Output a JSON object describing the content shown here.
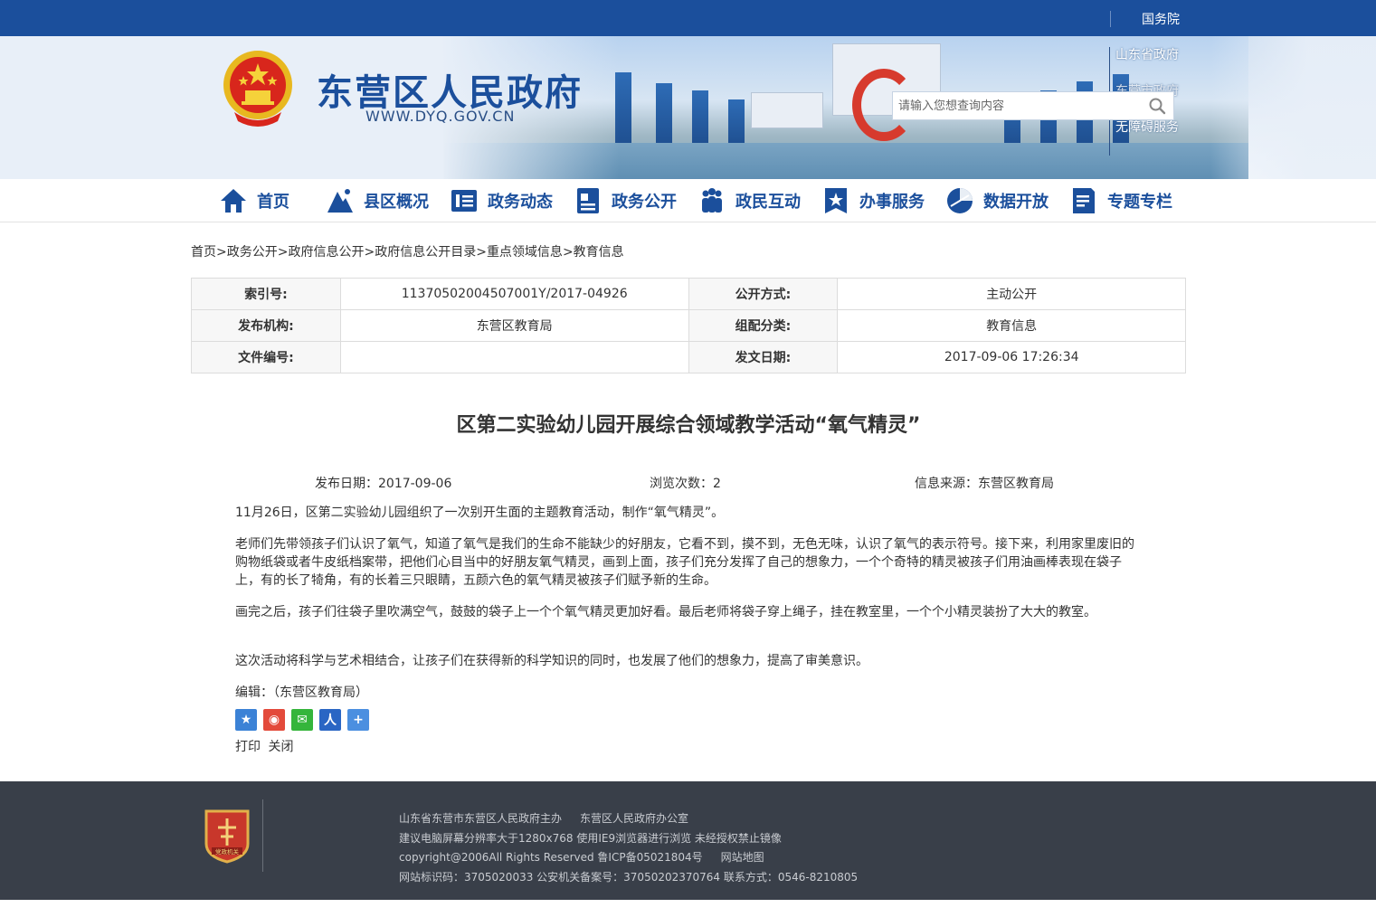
{
  "topbar": {
    "state_council": "国务院"
  },
  "header": {
    "site_title": "东营区人民政府",
    "site_url": "WWW.DYQ.GOV.CN",
    "side_links": [
      "山东省政府",
      "东营市政府",
      "无障碍服务"
    ],
    "search_placeholder": "请输入您想查询内容"
  },
  "nav": {
    "items": [
      {
        "label": "首页",
        "icon": "home-icon"
      },
      {
        "label": "县区概况",
        "icon": "mountain-icon"
      },
      {
        "label": "政务动态",
        "icon": "news-icon"
      },
      {
        "label": "政务公开",
        "icon": "document-icon"
      },
      {
        "label": "政民互动",
        "icon": "people-icon"
      },
      {
        "label": "办事服务",
        "icon": "service-star-icon"
      },
      {
        "label": "数据开放",
        "icon": "data-chart-icon"
      },
      {
        "label": "专题专栏",
        "icon": "topic-icon"
      }
    ]
  },
  "breadcrumb": [
    "首页",
    "政务公开",
    "政府信息公开",
    "政府信息公开目录",
    "重点领域信息",
    "教育信息"
  ],
  "info": {
    "index_label": "索引号:",
    "index_value": "11370502004507001Y/2017-04926",
    "method_label": "公开方式:",
    "method_value": "主动公开",
    "publisher_label": "发布机构:",
    "publisher_value": "东营区教育局",
    "category_label": "组配分类:",
    "category_value": "教育信息",
    "doc_no_label": "文件编号:",
    "doc_no_value": "",
    "issue_date_label": "发文日期:",
    "issue_date_value": "2017-09-06 17:26:34"
  },
  "article": {
    "title": "区第二实验幼儿园开展综合领域教学活动“氧气精灵”",
    "publish_date": "发布日期：2017-09-06",
    "views": "浏览次数：2",
    "source": "信息来源：东营区教育局",
    "paragraphs": [
      "11月26日，区第二实验幼儿园组织了一次别开生面的主题教育活动，制作“氧气精灵”。",
      "老师们先带领孩子们认识了氧气，知道了氧气是我们的生命不能缺少的好朋友，它看不到，摸不到，无色无味，认识了氧气的表示符号。接下来，利用家里废旧的购物纸袋或者牛皮纸档案带，把他们心目当中的好朋友氧气精灵，画到上面，孩子们充分发挥了自己的想象力，一个个奇特的精灵被孩子们用油画棒表现在袋子上，有的长了犄角，有的长着三只眼睛，五颜六色的氧气精灵被孩子们赋予新的生命。",
      "画完之后，孩子们往袋子里吹满空气，鼓鼓的袋子上一个个氧气精灵更加好看。最后老师将袋子穿上绳子，挂在教室里，一个个小精灵装扮了大大的教室。",
      "这次活动将科学与艺术相结合，让孩子们在获得新的科学知识的同时，也发展了他们的想象力，提高了审美意识。"
    ],
    "editor": "编辑：（东营区教育局）"
  },
  "actions": {
    "print": "打印",
    "close": "关闭"
  },
  "footer": {
    "sponsor": "山东省东营市东营区人民政府主办",
    "office": "东营区人民政府办公室",
    "resolution_note": "建议电脑屏幕分辨率大于1280x768 使用IE9浏览器进行浏览 未经授权禁止镜像",
    "copyright": "copyright@2006All Rights Reserved 鲁ICP备05021804号",
    "sitemap": "网站地图",
    "ids": "网站标识码：3705020033 公安机关备案号：37050202370764 联系方式：0546-8210805"
  },
  "colors": {
    "brand_blue": "#1b4f9c",
    "footer_bg": "#393f49"
  }
}
